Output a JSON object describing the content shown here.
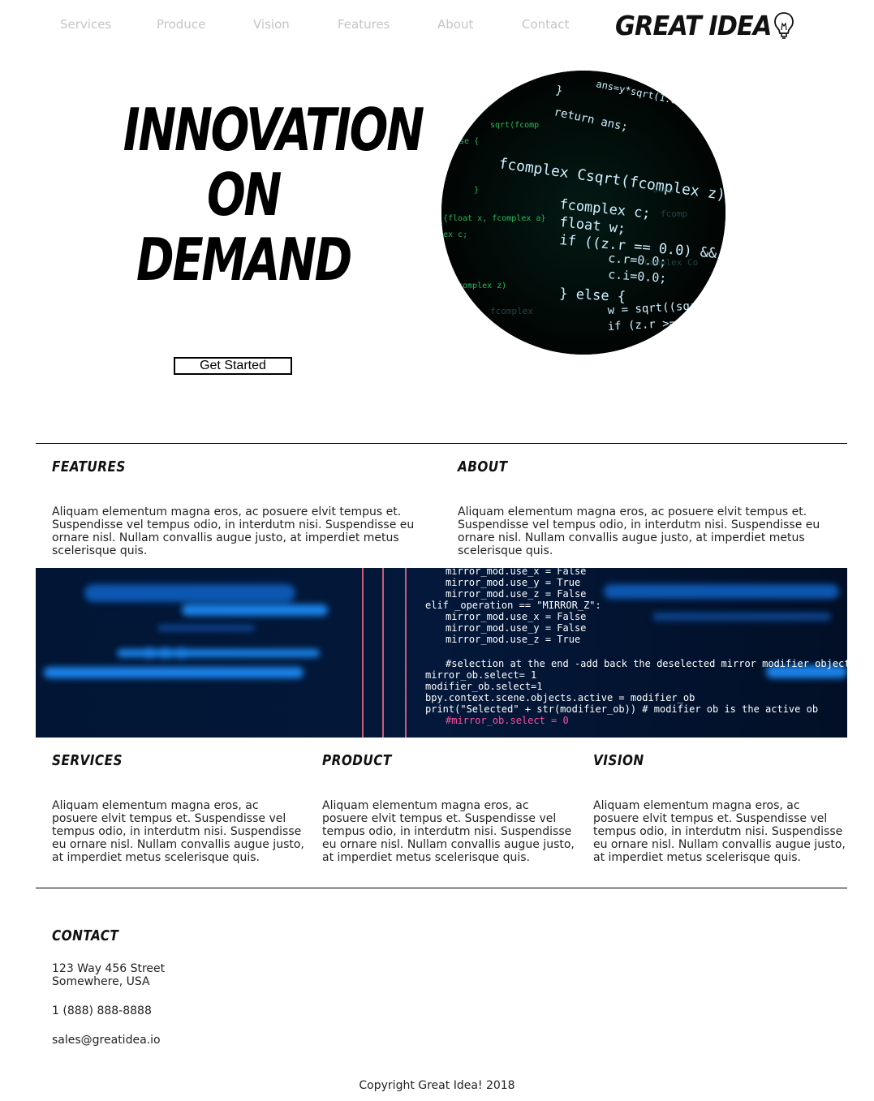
{
  "nav": {
    "items": [
      "Services",
      "Produce",
      "Vision",
      "Features",
      "About",
      "Contact"
    ],
    "logo_text": "GREAT IDEA"
  },
  "hero": {
    "title_lines": [
      "INNOVATION",
      "ON",
      "DEMAND"
    ],
    "cta_label": "Get Started",
    "image_icon": "code-screen-image"
  },
  "sections_top": [
    {
      "heading": "FEATURES",
      "body": "Aliquam elementum magna eros, ac posuere elvit tempus et. Suspendisse vel tempus odio, in interdutm nisi. Suspendisse eu ornare nisl. Nullam convallis augue justo, at imperdiet metus scelerisque quis."
    },
    {
      "heading": "ABOUT",
      "body": "Aliquam elementum magna eros, ac posuere elvit tempus et. Suspendisse vel tempus odio, in interdutm nisi. Suspendisse eu ornare nisl. Nullam convallis augue justo, at imperdiet metus scelerisque quis."
    }
  ],
  "banner_icon": "code-banner-image",
  "sections_bottom": [
    {
      "heading": "SERVICES",
      "body": "Aliquam elementum magna eros, ac posuere elvit tempus et. Suspendisse vel tempus odio, in interdutm nisi. Suspendisse eu ornare nisl. Nullam convallis augue justo, at imperdiet metus scelerisque quis."
    },
    {
      "heading": "PRODUCT",
      "body": "Aliquam elementum magna eros, ac posuere elvit tempus et. Suspendisse vel tempus odio, in interdutm nisi. Suspendisse eu ornare nisl. Nullam convallis augue justo, at imperdiet metus scelerisque quis."
    },
    {
      "heading": "VISION",
      "body": "Aliquam elementum magna eros, ac posuere elvit tempus et. Suspendisse vel tempus odio, in interdutm nisi. Suspendisse eu ornare nisl. Nullam convallis augue justo, at imperdiet metus scelerisque quis."
    }
  ],
  "contact": {
    "heading": "CONTACT",
    "address_line1": "123 Way 456 Street",
    "address_line2": "Somewhere, USA",
    "phone": "1 (888) 888-8888",
    "email": "sales@greatidea.io"
  },
  "footer": {
    "copyright": "Copyright Great Idea! 2018"
  }
}
